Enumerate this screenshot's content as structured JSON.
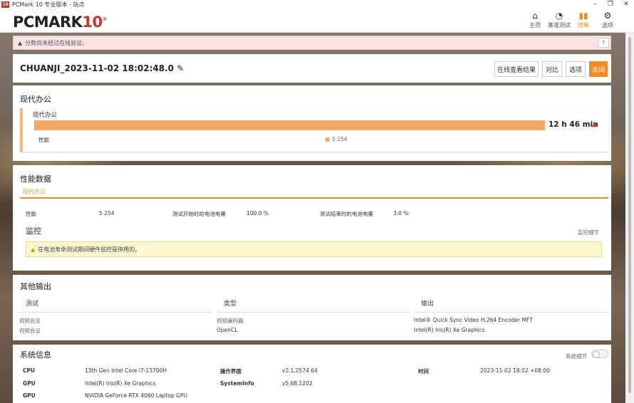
{
  "window": {
    "title": "PCMark 10 专业版本 - 站点",
    "logo": "10"
  },
  "brand": {
    "name": "PCMARK",
    "ten": "10",
    "reg": "®"
  },
  "nav": [
    {
      "label": "主页",
      "icon": "home-icon"
    },
    {
      "label": "基准测试",
      "icon": "gauge-icon"
    },
    {
      "label": "结果",
      "icon": "bar-chart-icon"
    },
    {
      "label": "选项",
      "icon": "gear-icon"
    }
  ],
  "banner": {
    "text": "分数尚未经过在线验证。",
    "help": "?"
  },
  "run": {
    "title": "CHUANJI_2023-11-02 18:02:48.0",
    "buttons": {
      "online": "在线查看结果",
      "compare": "对比",
      "options": "选项",
      "close": "关闭"
    }
  },
  "office": {
    "section_title": "现代办公",
    "test_name": "现代办公",
    "duration": "12 h 46 min",
    "perf_label": "性能",
    "perf_value": "5 254",
    "bar_fraction": 1.0
  },
  "perf": {
    "title": "性能数据",
    "tab": "现代办公",
    "rows": [
      {
        "label": "性能",
        "value": "5 254"
      },
      {
        "label": "测试开始时的电池电量",
        "value": "100.0 %"
      },
      {
        "label": "测试结束时的电池电量",
        "value": "3.0 %"
      }
    ],
    "monitor_title": "监控",
    "monitor_detail": "监控细节",
    "monitor_warning": "在电池寿命测试期间硬件监控是停用的。"
  },
  "other": {
    "title": "其他输出",
    "headers": [
      "测试",
      "类型",
      "输出"
    ],
    "rows": [
      [
        "视频会议",
        "视频编码器",
        "Intel® Quick Sync Video H.264 Encoder MFT"
      ],
      [
        "视频会议",
        "OpenCL",
        "Intel(R) Iris(R) Xe Graphics"
      ]
    ]
  },
  "sys": {
    "title": "系统信息",
    "detail_toggle": "系统细节",
    "items": [
      {
        "label": "CPU",
        "value": "13th Gen Intel Core i7-13700H"
      },
      {
        "label": "GPU",
        "value": "Intel(R) Iris(R) Xe Graphics"
      },
      {
        "label": "GPU",
        "value": "NVIDIA GeForce RTX 4060 Laptop GPU"
      },
      {
        "label": "操作界面",
        "value": "v2.1.2574 64"
      },
      {
        "label": "SystemInfo",
        "value": "v5.68.1202"
      },
      {
        "label": "时间",
        "value": "2023-11-02 18:02 +08:00"
      }
    ]
  }
}
